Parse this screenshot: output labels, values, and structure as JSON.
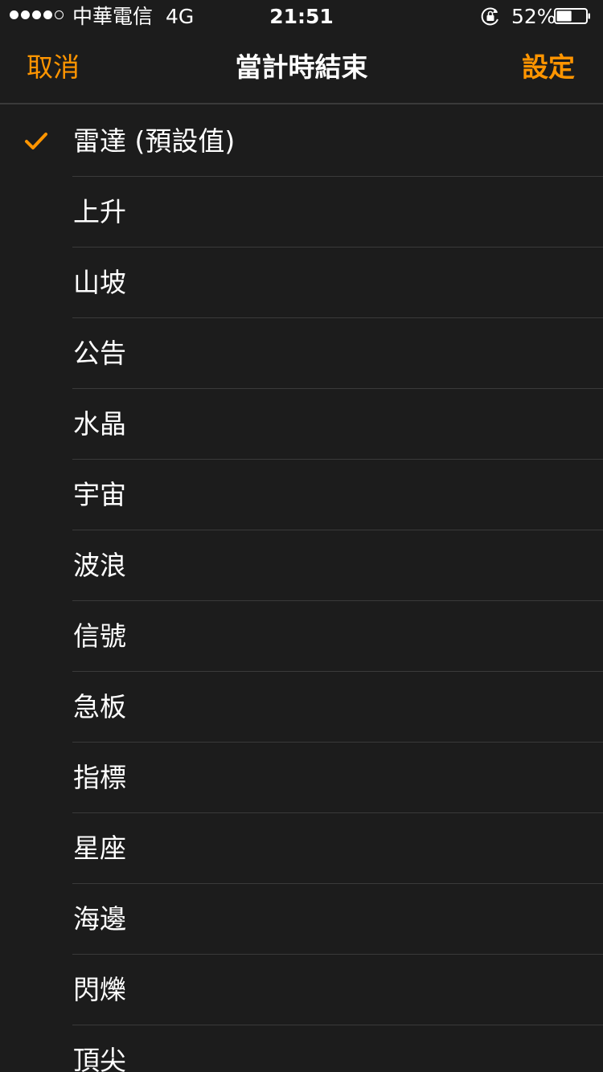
{
  "status_bar": {
    "carrier": "中華電信",
    "network": "4G",
    "time": "21:51",
    "battery_percent": "52%",
    "battery_level": 0.52,
    "signal_bars_filled": 4,
    "signal_bars_total": 5,
    "orientation_lock_icon": "rotation-lock-icon"
  },
  "nav": {
    "cancel_label": "取消",
    "title": "當計時結束",
    "set_label": "設定"
  },
  "sounds": [
    {
      "label": "雷達 (預設值)",
      "selected": true
    },
    {
      "label": "上升",
      "selected": false
    },
    {
      "label": "山坡",
      "selected": false
    },
    {
      "label": "公告",
      "selected": false
    },
    {
      "label": "水晶",
      "selected": false
    },
    {
      "label": "宇宙",
      "selected": false
    },
    {
      "label": "波浪",
      "selected": false
    },
    {
      "label": "信號",
      "selected": false
    },
    {
      "label": "急板",
      "selected": false
    },
    {
      "label": "指標",
      "selected": false
    },
    {
      "label": "星座",
      "selected": false
    },
    {
      "label": "海邊",
      "selected": false
    },
    {
      "label": "閃爍",
      "selected": false
    },
    {
      "label": "頂尖",
      "selected": false
    }
  ],
  "colors": {
    "accent": "#ff9500",
    "background": "#1c1c1c",
    "separator": "#3a3a3a",
    "text": "#ffffff"
  }
}
